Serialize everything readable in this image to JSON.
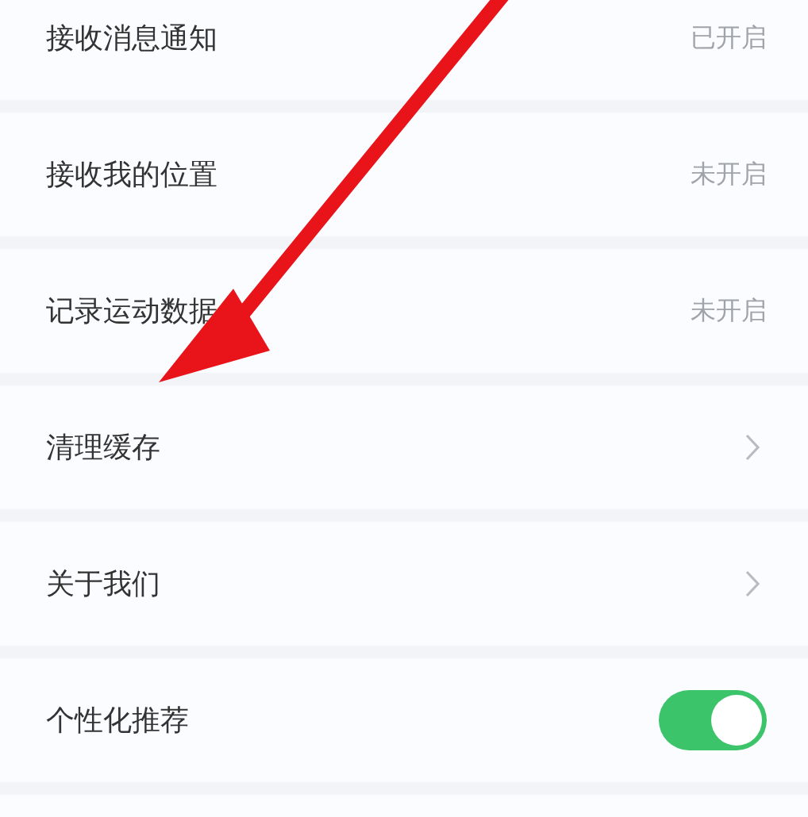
{
  "settings": [
    {
      "kind": "value",
      "label": "接收消息通知",
      "value": "已开启"
    },
    {
      "kind": "value",
      "label": "接收我的位置",
      "value": "未开启"
    },
    {
      "kind": "value",
      "label": "记录运动数据",
      "value": "未开启"
    },
    {
      "kind": "link",
      "label": "清理缓存"
    },
    {
      "kind": "link",
      "label": "关于我们"
    },
    {
      "kind": "toggle",
      "label": "个性化推荐",
      "on": true
    }
  ]
}
